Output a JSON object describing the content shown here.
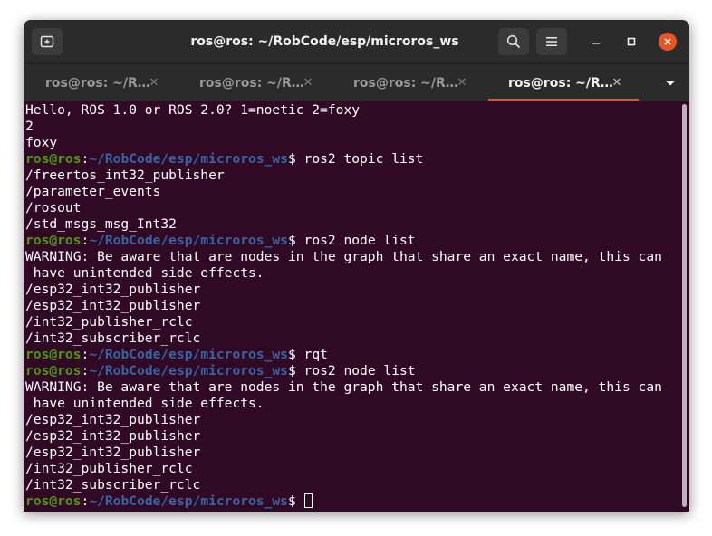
{
  "window": {
    "title": "ros@ros: ~/RobCode/esp/microros_ws",
    "new_tab_icon": "new-tab-icon",
    "search_icon": "search-icon",
    "menu_icon": "hamburger-menu-icon",
    "minimize_icon": "minimize-icon",
    "maximize_icon": "maximize-icon",
    "close_icon": "close-icon",
    "close_color": "#e95420"
  },
  "tabs": [
    {
      "label": "ros@ros: ~/R…",
      "active": false
    },
    {
      "label": "ros@ros: ~/R…",
      "active": false
    },
    {
      "label": "ros@ros: ~/R…",
      "active": false
    },
    {
      "label": "ros@ros: ~/R…",
      "active": true
    }
  ],
  "tab_close_glyph": "✕",
  "tab_menu_icon": "chevron-down-icon",
  "prompt": {
    "user": "ros@ros",
    "colon": ":",
    "path": "~/RobCode/esp/microros_ws",
    "dollar": "$ "
  },
  "terminal": {
    "background": "#300a24",
    "user_color": "#4e9a06",
    "path_color": "#3465a4",
    "lines": [
      {
        "type": "output",
        "text": "Hello, ROS 1.0 or ROS 2.0? 1=noetic 2=foxy"
      },
      {
        "type": "output",
        "text": "2"
      },
      {
        "type": "output",
        "text": "foxy"
      },
      {
        "type": "prompt",
        "text": "ros2 topic list"
      },
      {
        "type": "output",
        "text": "/freertos_int32_publisher"
      },
      {
        "type": "output",
        "text": "/parameter_events"
      },
      {
        "type": "output",
        "text": "/rosout"
      },
      {
        "type": "output",
        "text": "/std_msgs_msg_Int32"
      },
      {
        "type": "prompt",
        "text": "ros2 node list"
      },
      {
        "type": "output",
        "text": "WARNING: Be aware that are nodes in the graph that share an exact name, this can"
      },
      {
        "type": "output",
        "text": " have unintended side effects."
      },
      {
        "type": "output",
        "text": "/esp32_int32_publisher"
      },
      {
        "type": "output",
        "text": "/esp32_int32_publisher"
      },
      {
        "type": "output",
        "text": "/int32_publisher_rclc"
      },
      {
        "type": "output",
        "text": "/int32_subscriber_rclc"
      },
      {
        "type": "prompt",
        "text": "rqt"
      },
      {
        "type": "prompt",
        "text": "ros2 node list"
      },
      {
        "type": "output",
        "text": "WARNING: Be aware that are nodes in the graph that share an exact name, this can"
      },
      {
        "type": "output",
        "text": " have unintended side effects."
      },
      {
        "type": "output",
        "text": "/esp32_int32_publisher"
      },
      {
        "type": "output",
        "text": "/esp32_int32_publisher"
      },
      {
        "type": "output",
        "text": "/esp32_int32_publisher"
      },
      {
        "type": "output",
        "text": "/int32_publisher_rclc"
      },
      {
        "type": "output",
        "text": "/int32_subscriber_rclc"
      },
      {
        "type": "prompt",
        "text": "",
        "cursor": true
      }
    ]
  }
}
